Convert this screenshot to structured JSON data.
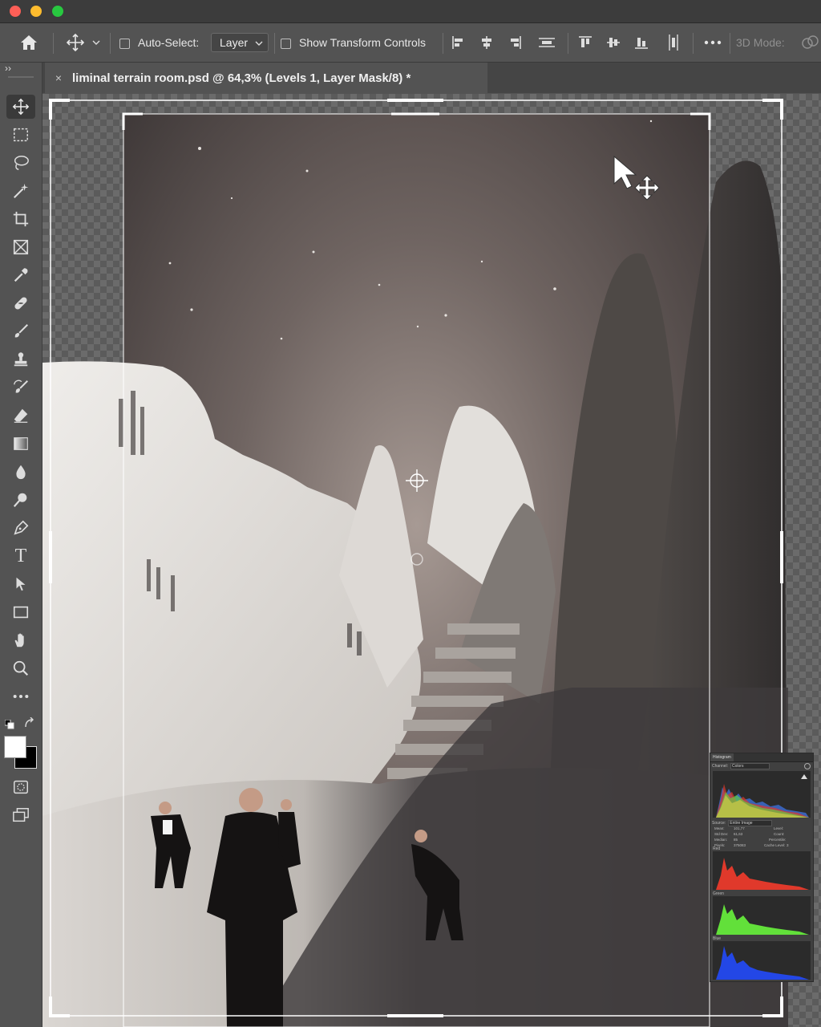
{
  "app": {
    "window_controls": [
      "close",
      "minimize",
      "zoom"
    ]
  },
  "options_bar": {
    "home_icon": "home-icon",
    "move_tool_icon": "move-icon",
    "auto_select_label": "Auto-Select:",
    "auto_select_checked": false,
    "auto_select_target": "Layer",
    "show_transform_label": "Show Transform Controls",
    "show_transform_checked": false,
    "align_icons": [
      "align-left-edges",
      "align-horizontal-centers",
      "align-right-edges",
      "distribute-vertical",
      "align-top-edges",
      "align-vertical-centers",
      "align-bottom-edges",
      "distribute-horizontal"
    ],
    "more_icon": "more-icon",
    "mode_label": "3D Mode:"
  },
  "document_tab": {
    "title": "liminal terrain room.psd @ 64,3% (Levels 1, Layer Mask/8) *",
    "close_symbol": "×"
  },
  "toolbar": {
    "collapse_symbol": "››",
    "tools": [
      {
        "name": "move-tool",
        "icon": "move-icon",
        "active": true
      },
      {
        "name": "rectangular-marquee-tool",
        "icon": "marquee-icon"
      },
      {
        "name": "lasso-tool",
        "icon": "lasso-icon"
      },
      {
        "name": "magic-wand-tool",
        "icon": "magic-wand-icon"
      },
      {
        "name": "crop-tool",
        "icon": "crop-icon"
      },
      {
        "name": "frame-tool",
        "icon": "frame-icon"
      },
      {
        "name": "eyedropper-tool",
        "icon": "eyedropper-icon"
      },
      {
        "name": "healing-brush-tool",
        "icon": "bandage-icon"
      },
      {
        "name": "brush-tool",
        "icon": "brush-icon"
      },
      {
        "name": "clone-stamp-tool",
        "icon": "stamp-icon"
      },
      {
        "name": "history-brush-tool",
        "icon": "history-brush-icon"
      },
      {
        "name": "eraser-tool",
        "icon": "eraser-icon"
      },
      {
        "name": "gradient-tool",
        "icon": "gradient-icon"
      },
      {
        "name": "blur-tool",
        "icon": "drop-icon"
      },
      {
        "name": "dodge-tool",
        "icon": "dodge-icon"
      },
      {
        "name": "pen-tool",
        "icon": "pen-icon"
      },
      {
        "name": "type-tool",
        "icon": "type-icon"
      },
      {
        "name": "path-selection-tool",
        "icon": "arrow-icon"
      },
      {
        "name": "rectangle-tool",
        "icon": "rectangle-icon"
      },
      {
        "name": "hand-tool",
        "icon": "hand-icon"
      },
      {
        "name": "zoom-tool",
        "icon": "zoom-icon"
      },
      {
        "name": "edit-toolbar",
        "icon": "ellipsis-icon"
      }
    ],
    "foreground_color": "#ffffff",
    "background_color": "#000000",
    "type_glyph": "T"
  },
  "histogram_panel": {
    "tab_label": "Histogram",
    "channel_label": "Channel:",
    "channel_value": "Colors",
    "source_label": "Source:",
    "source_value": "Entire Image",
    "stats": {
      "mean_label": "Mean:",
      "mean": "101,77",
      "std_label": "Std Dev:",
      "std": "61,63",
      "median_label": "Median:",
      "median": "85",
      "pixels_label": "Pixels:",
      "pixels": "375083",
      "level_label": "Level:",
      "count_label": "Count:",
      "percentile_label": "Percentile:",
      "cache_label": "Cache Level:",
      "cache": "3"
    },
    "red_label": "Red",
    "green_label": "Green",
    "blue_label": "Blue",
    "colors": {
      "red": "#e0392b",
      "green": "#62e03a",
      "blue": "#2347e6"
    }
  },
  "colors": {
    "ui_panel": "#535353",
    "titlebar": "#3c3c3c"
  }
}
